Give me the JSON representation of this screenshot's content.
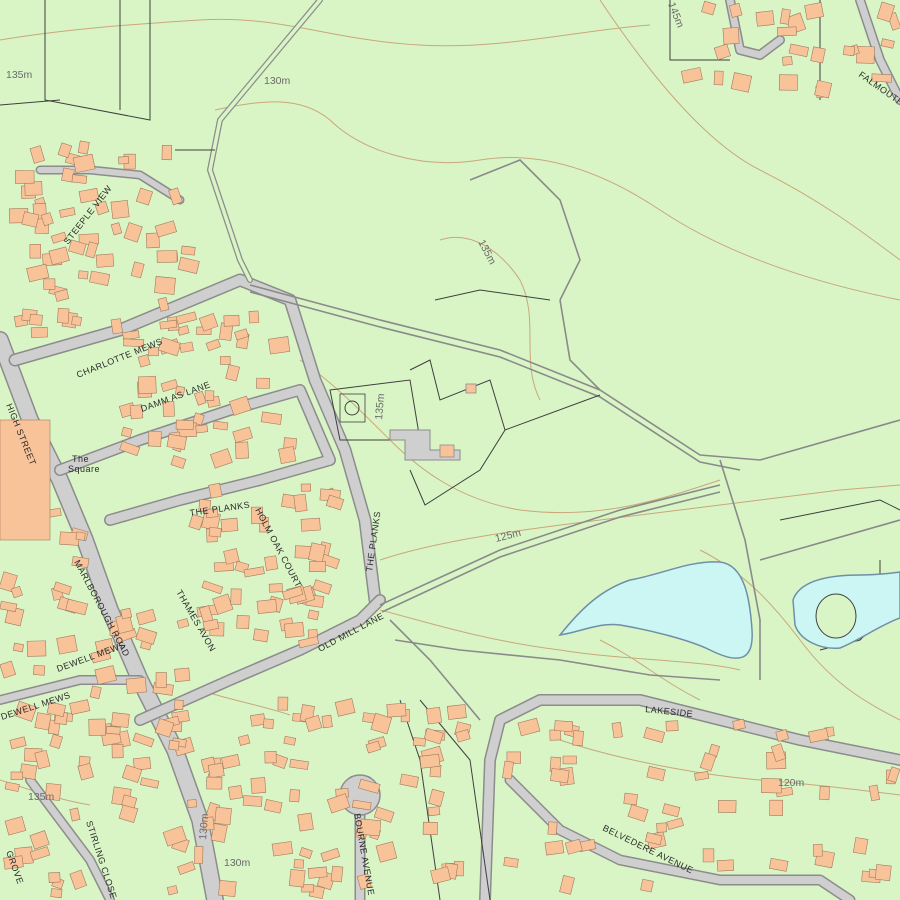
{
  "map": {
    "colors": {
      "land": "#d9f5c6",
      "building": "#f9c39a",
      "road": "#cfcfcf",
      "road_edge": "#8c8c8c",
      "water": "#ccf6f4",
      "water_edge": "#6f8fa6",
      "contour": "#c9a77a",
      "boundary": "#3f3f3f"
    },
    "streets": {
      "high_street": "HIGH STREET",
      "charlotte_mews": "CHARLOTTE MEWS",
      "damm_as_lane": "DAMM AS LANE",
      "the_square_1": "The",
      "the_square_2": "Square",
      "the_planks_west": "THE PLANKS",
      "holm_oak_court": "HOLM OAK COURT",
      "the_planks_east": "THE PLANKS",
      "thames_avon": "THAMES AVON",
      "old_mill_lane": "OLD MILL LANE",
      "marlborough_road": "MARLBOROUGH ROAD",
      "dewell_mews_1": "DEWELL MEWS",
      "dewell_mews_2": "DEWELL MEWS",
      "steeple_view": "STEEPLE VIEW",
      "lakeside": "LAKESIDE",
      "dunwell_avenue": "BELVEDERE AVENUE",
      "bourne_avenue": "BOURNE AVENUE",
      "stirling_close": "STIRLING CLOSE",
      "falmouth": "FALMOUTH",
      "grove": "GROVE"
    },
    "contours": {
      "c135_nw": "135m",
      "c130_n": "130m",
      "c145_ne": "145m",
      "c135_hill": "135m",
      "c135_centre": "135m",
      "c125": "125m",
      "c120": "120m",
      "c135_sw": "135m",
      "c130_s": "130m",
      "c130_sw2": "130m"
    }
  }
}
